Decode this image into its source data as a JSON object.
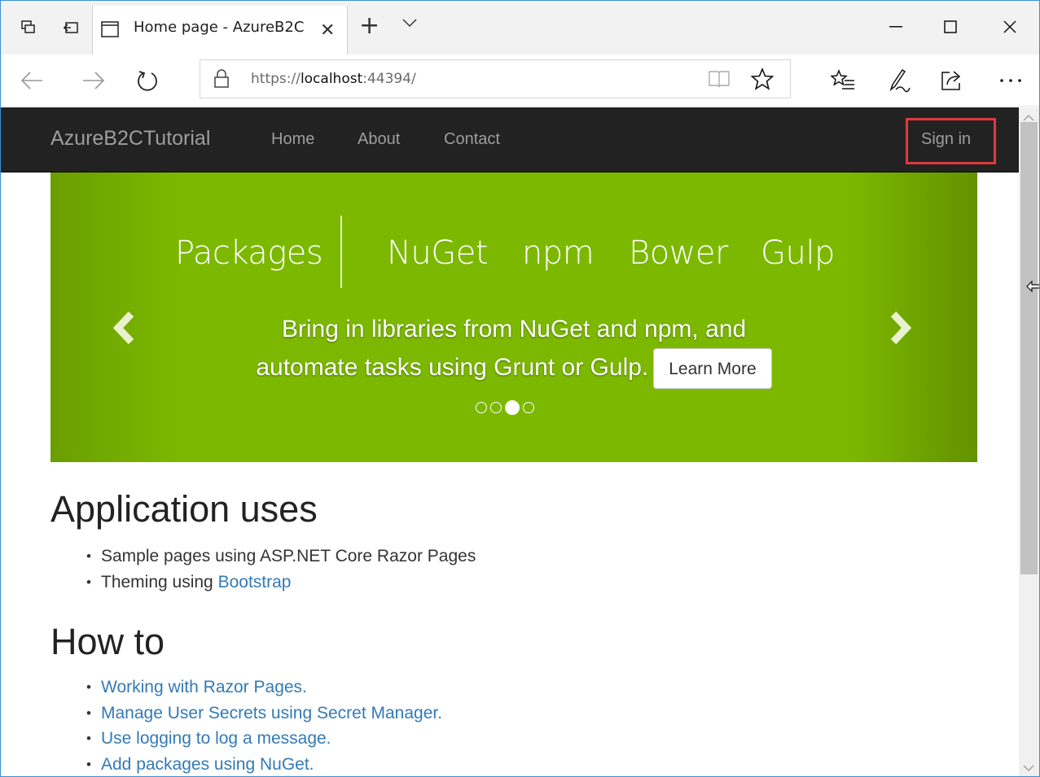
{
  "browser": {
    "tab_title": "Home page - AzureB2C",
    "url_scheme": "https://",
    "url_host": "localhost",
    "url_port_path": ":44394/",
    "icons": [
      "tab-preview-icon",
      "set-aside-tabs-icon",
      "page-icon",
      "close-icon",
      "new-tab-icon",
      "tab-list-chevron-icon",
      "minimize-icon",
      "maximize-icon",
      "window-close-icon",
      "back-icon",
      "forward-icon",
      "refresh-icon",
      "lock-icon",
      "reading-view-icon",
      "favorite-star-icon",
      "favorites-hub-icon",
      "web-note-icon",
      "share-icon",
      "more-icon"
    ]
  },
  "navbar": {
    "brand": "AzureB2CTutorial",
    "links": [
      "Home",
      "About",
      "Contact"
    ],
    "sign_in": "Sign in",
    "highlight_color": "#e0393e"
  },
  "carousel": {
    "titles": [
      "Packages",
      "NuGet",
      "npm",
      "Bower",
      "Gulp"
    ],
    "caption_line1": "Bring in libraries from NuGet and npm, and",
    "caption_line2": "automate tasks using Grunt or Gulp.",
    "button": "Learn More",
    "slide_count": 4,
    "active_slide": 3,
    "color": "#7cb800"
  },
  "sections": [
    {
      "heading": "Application uses",
      "items": [
        {
          "text": "Sample pages using ASP.NET Core Razor Pages",
          "link": ""
        },
        {
          "text": "Theming using ",
          "link": "Bootstrap"
        }
      ]
    },
    {
      "heading": "How to",
      "items": [
        {
          "text": "",
          "link": "Working with Razor Pages."
        },
        {
          "text": "",
          "link": "Manage User Secrets using Secret Manager."
        },
        {
          "text": "",
          "link": "Use logging to log a message."
        },
        {
          "text": "",
          "link": "Add packages using NuGet."
        }
      ]
    }
  ]
}
